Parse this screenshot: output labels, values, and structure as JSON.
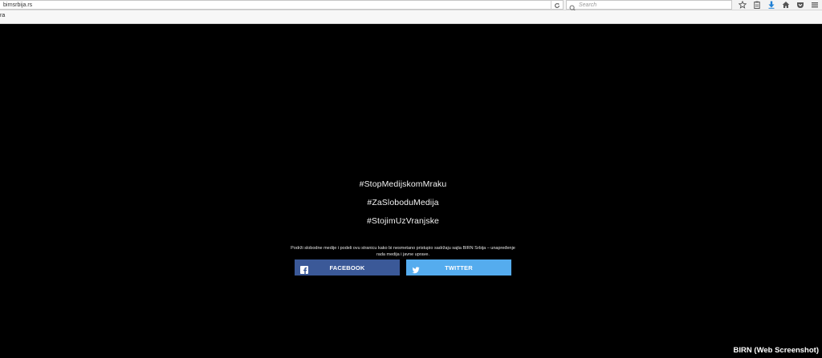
{
  "browser": {
    "url": "birnsrbija.rs",
    "search_placeholder": "Search",
    "bookmark_label": "ra",
    "icons": [
      "star-icon",
      "clipboard-icon",
      "download-icon",
      "home-icon",
      "pocket-icon",
      "menu-icon"
    ]
  },
  "page": {
    "hashtags": [
      "#StopMedijskomMraku",
      "#ZaSloboduMedija",
      "#StojimUzVranjske"
    ],
    "support_text": "Podrži slobodne medije i podeli ovu stranicu kako bi nesmetano pristupio sadržaju sajta BIRN Srbija – unapređenje rada medija i javne uprave.",
    "facebook_label": "FACEBOOK",
    "twitter_label": "TWITTER",
    "facebook_color": "#3b5998",
    "twitter_color": "#55acee"
  },
  "credit": "BIRN (Web Screenshot)"
}
